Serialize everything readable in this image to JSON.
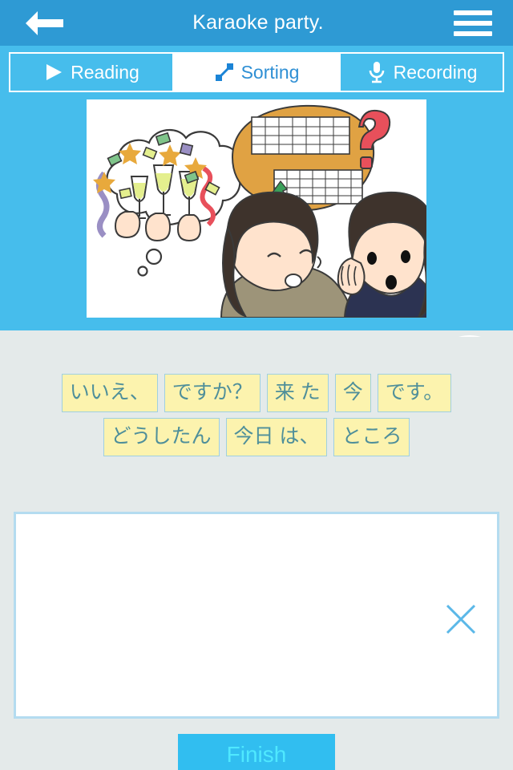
{
  "header": {
    "title": "Karaoke party.",
    "back_icon": "back-arrow-icon",
    "menu_icon": "hamburger-menu-icon",
    "bg_color": "#2e9ad4"
  },
  "tabs": [
    {
      "id": "reading",
      "label": "Reading",
      "icon": "play-triangle-icon",
      "active": false
    },
    {
      "id": "sorting",
      "label": "Sorting",
      "icon": "sort-diagonal-icon",
      "active": true
    },
    {
      "id": "recording",
      "label": "Recording",
      "icon": "microphone-icon",
      "active": false
    }
  ],
  "media": {
    "illustration_alt": "Two women talking; one imagines a champagne toast celebration, the other thinks of a calendar with a question mark",
    "play_button_icon": "play-icon",
    "progress_percent": 100,
    "panel_color": "#46bdec"
  },
  "sorting": {
    "rows": [
      [
        "いいえ、",
        "ですか？",
        "来 た",
        "今",
        "です。"
      ],
      [
        "どうしたん",
        "今日 は、",
        "ところ"
      ]
    ],
    "token_bg": "#fcf3ae",
    "token_border": "#9fd0e0",
    "token_text_color": "#4f8f9a"
  },
  "answer": {
    "value": "",
    "placeholder": "",
    "clear_icon": "close-x-icon"
  },
  "footer": {
    "finish_label": "Finish",
    "finish_bg": "#31bef0",
    "finish_text_color": "#4fe8ff"
  }
}
